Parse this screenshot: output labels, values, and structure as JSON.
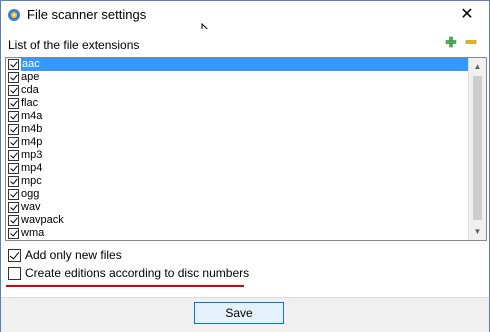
{
  "window": {
    "title": "File scanner settings",
    "close_glyph": "✕"
  },
  "icons": {
    "app": "app-icon",
    "add": "plus-icon",
    "remove": "minus-icon",
    "close": "close-icon",
    "cursor": "cursor-icon"
  },
  "list": {
    "header": "List of the file extensions",
    "items": [
      {
        "label": "aac",
        "checked": true,
        "selected": true
      },
      {
        "label": "ape",
        "checked": true
      },
      {
        "label": "cda",
        "checked": true
      },
      {
        "label": "flac",
        "checked": true
      },
      {
        "label": "m4a",
        "checked": true
      },
      {
        "label": "m4b",
        "checked": true
      },
      {
        "label": "m4p",
        "checked": true
      },
      {
        "label": "mp3",
        "checked": true
      },
      {
        "label": "mp4",
        "checked": true
      },
      {
        "label": "mpc",
        "checked": true
      },
      {
        "label": "ogg",
        "checked": true
      },
      {
        "label": "wav",
        "checked": true
      },
      {
        "label": "wavpack",
        "checked": true
      },
      {
        "label": "wma",
        "checked": true
      }
    ]
  },
  "options": {
    "add_only_new": {
      "label": "Add only new files",
      "checked": true
    },
    "create_editions": {
      "label": "Create editions according to disc numbers",
      "checked": false
    }
  },
  "footer": {
    "save_label": "Save"
  },
  "colors": {
    "selection": "#3399ff",
    "highlight_line": "#e00000",
    "add_icon": "#4caf50",
    "remove_icon": "#e6b800",
    "button_border": "#0078d7"
  }
}
